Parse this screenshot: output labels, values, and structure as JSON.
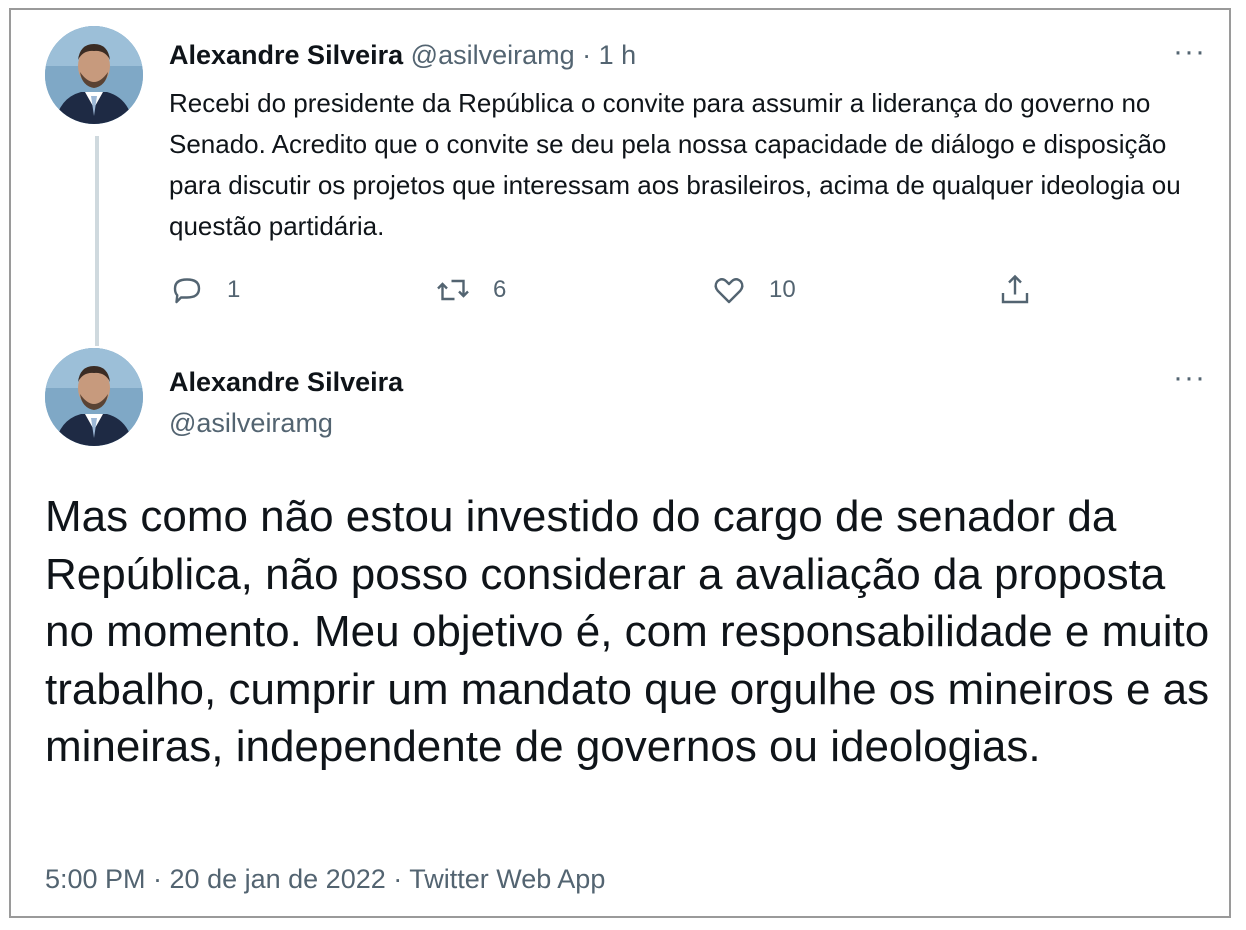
{
  "tweet1": {
    "author_name": "Alexandre Silveira",
    "handle": "@asilveiramg",
    "separator": "·",
    "time": "1 h",
    "text": "Recebi do presidente da República o convite para assumir a liderança do governo no Senado. Acredito que o convite se deu pela nossa capacidade de diálogo e disposição para discutir os projetos que interessam aos brasileiros, acima de qualquer ideologia ou questão partidária.",
    "more_label": "···",
    "replies": "1",
    "retweets": "6",
    "likes": "10"
  },
  "tweet2": {
    "author_name": "Alexandre Silveira",
    "handle": "@asilveiramg",
    "more_label": "···",
    "text": "Mas como não estou investido do cargo de senador da República, não posso considerar a avaliação da proposta no momento. Meu objetivo é, com responsabilidade e muito trabalho, cumprir um mandato que orgulhe os mineiros e as mineiras, independente de governos ou ideologias.",
    "meta": "5:00 PM · 20 de jan de 2022 · Twitter Web App"
  },
  "colors": {
    "text": "#0f1419",
    "muted": "#536471",
    "thread_line": "#cfd9de",
    "border": "#9a9a9a"
  },
  "icons": [
    "avatar",
    "reply-icon",
    "retweet-icon",
    "like-icon",
    "share-icon",
    "more-icon"
  ]
}
